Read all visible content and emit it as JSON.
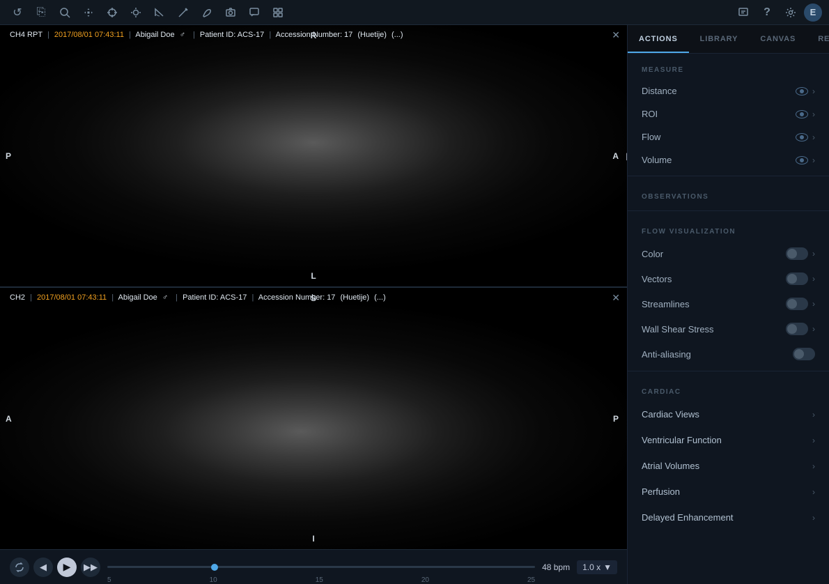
{
  "toolbar": {
    "icons_left": [
      {
        "name": "undo-icon",
        "symbol": "↺"
      },
      {
        "name": "copy-icon",
        "symbol": "⧉"
      },
      {
        "name": "zoom-icon",
        "symbol": "🔍"
      },
      {
        "name": "move-icon",
        "symbol": "✛"
      },
      {
        "name": "crosshair-icon",
        "symbol": "⊕"
      },
      {
        "name": "brightness-icon",
        "symbol": "☀"
      },
      {
        "name": "measure-icon",
        "symbol": "📐"
      },
      {
        "name": "cursor-icon",
        "symbol": "↗"
      },
      {
        "name": "edit-icon",
        "symbol": "✏"
      },
      {
        "name": "camera-icon",
        "symbol": "📷"
      },
      {
        "name": "comment-icon",
        "symbol": "💬"
      },
      {
        "name": "layout-icon",
        "symbol": "▦"
      }
    ],
    "icons_right": [
      {
        "name": "share-icon",
        "symbol": "🗨"
      },
      {
        "name": "help-icon",
        "symbol": "?"
      },
      {
        "name": "settings-icon",
        "symbol": "⚙"
      },
      {
        "name": "user-icon",
        "symbol": "E"
      }
    ]
  },
  "viewer": {
    "top": {
      "label": "CH4 RPT",
      "date": "2017/08/01",
      "time": "07:43:11",
      "patient": "Abigail Doe",
      "gender": "♂",
      "patient_id": "Patient ID: ACS-17",
      "accession": "Accession Number: 17",
      "series": "(Huetije)",
      "ellipsis": "(...)",
      "orientations": {
        "top": "R",
        "left": "P",
        "right": "A",
        "bottom": "L"
      }
    },
    "bottom": {
      "label": "CH2",
      "date": "2017/08/01",
      "time": "07:43:11",
      "patient": "Abigail Doe",
      "gender": "♂",
      "patient_id": "Patient ID: ACS-17",
      "accession": "Accession Number: 17",
      "series": "(Huetije)",
      "ellipsis": "(...)",
      "orientations": {
        "top": "S",
        "left": "A",
        "right": "P",
        "bottom": "I"
      }
    }
  },
  "playback": {
    "bpm_label": "48 bpm",
    "speed_label": "1.0 x",
    "ticks": [
      "5",
      "10",
      "15",
      "20",
      "25"
    ]
  },
  "tabs": [
    {
      "label": "ACTIONS",
      "active": true
    },
    {
      "label": "LIBRARY",
      "active": false
    },
    {
      "label": "CANVAS",
      "active": false
    },
    {
      "label": "REPORT",
      "active": false
    }
  ],
  "sections": {
    "measure": {
      "header": "MEASURE",
      "items": [
        {
          "label": "Distance",
          "has_eye": true,
          "has_chevron": true
        },
        {
          "label": "ROI",
          "has_eye": true,
          "has_chevron": true
        },
        {
          "label": "Flow",
          "has_eye": true,
          "has_chevron": true
        },
        {
          "label": "Volume",
          "has_eye": true,
          "has_chevron": true
        }
      ]
    },
    "observations": {
      "header": "OBSERVATIONS"
    },
    "flow_vis": {
      "header": "FLOW VISUALIZATION",
      "items": [
        {
          "label": "Color",
          "type": "toggle"
        },
        {
          "label": "Vectors",
          "type": "toggle"
        },
        {
          "label": "Streamlines",
          "type": "toggle"
        },
        {
          "label": "Wall Shear Stress",
          "type": "toggle"
        },
        {
          "label": "Anti-aliasing",
          "type": "toggle"
        }
      ]
    },
    "cardiac": {
      "header": "CARDIAC",
      "items": [
        {
          "label": "Cardiac Views"
        },
        {
          "label": "Ventricular Function"
        },
        {
          "label": "Atrial Volumes"
        },
        {
          "label": "Perfusion"
        },
        {
          "label": "Delayed Enhancement"
        }
      ]
    }
  }
}
